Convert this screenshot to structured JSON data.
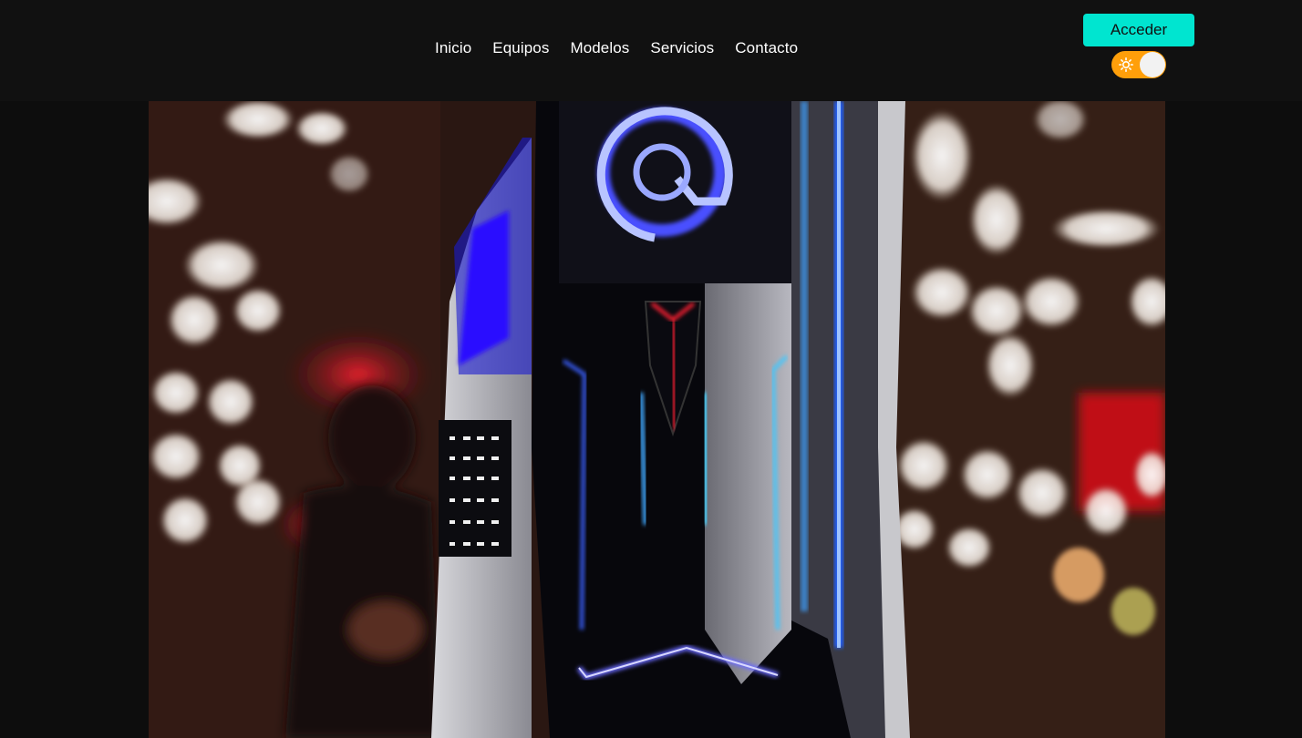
{
  "nav": {
    "items": [
      {
        "label": "Inicio"
      },
      {
        "label": "Equipos"
      },
      {
        "label": "Modelos"
      },
      {
        "label": "Servicios"
      },
      {
        "label": "Contacto"
      }
    ]
  },
  "header": {
    "login_label": "Acceder",
    "theme_toggle": {
      "icon": "sun-icon",
      "state": "light"
    }
  },
  "hero": {
    "image": "gaming-pc-tower-photo"
  },
  "colors": {
    "header_bg": "#111111",
    "page_bg": "#0d0d0d",
    "accent": "#00e5d0",
    "toggle": "#ff9f0a"
  }
}
